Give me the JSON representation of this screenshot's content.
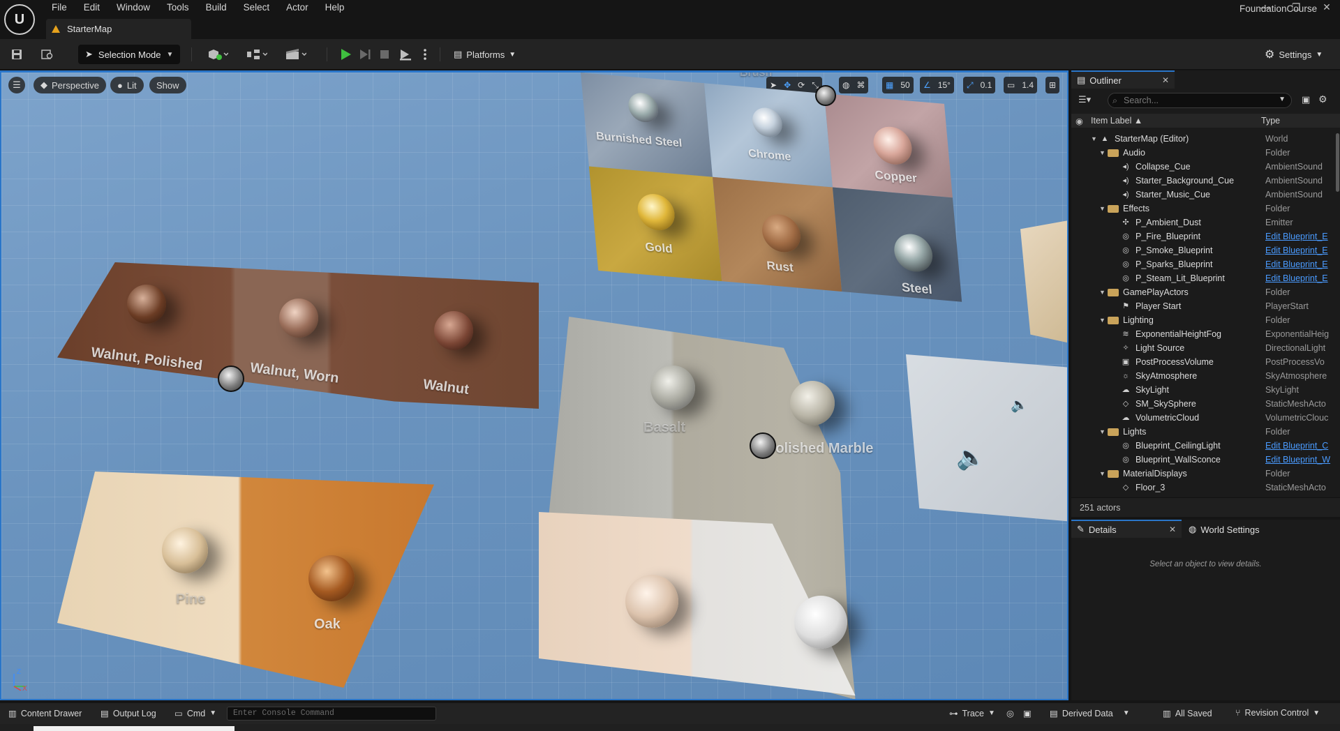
{
  "app": {
    "project_name": "FoundationCourse",
    "logo_letter": "U",
    "menu": [
      "File",
      "Edit",
      "Window",
      "Tools",
      "Build",
      "Select",
      "Actor",
      "Help"
    ],
    "map_tab": "StarterMap",
    "window_controls": [
      "—",
      "❐",
      "✕"
    ]
  },
  "toolbar": {
    "selection_mode": "Selection Mode",
    "platforms": "Platforms",
    "settings": "Settings",
    "icons": [
      "save-icon",
      "browse-icon",
      "add-actor-icon",
      "blueprint-icon",
      "cinematics-icon",
      "play-icon",
      "step-icon",
      "stop-icon",
      "eject-icon",
      "more-icon",
      "platforms-icon",
      "gear-icon"
    ],
    "colors": {
      "play": "#3fbf3f"
    }
  },
  "viewport": {
    "view_mode_perspective": "Perspective",
    "view_mode_lit": "Lit",
    "show": "Show",
    "grid_snap": "50",
    "rotation_snap": "15°",
    "scale_snap": "0.1",
    "camera_speed": "1.4",
    "accent": "#2a76c9",
    "material_tiles": [
      {
        "label": "Burnished Steel"
      },
      {
        "label": "Chrome"
      },
      {
        "label": "Copper"
      },
      {
        "label": "Gold"
      },
      {
        "label": "Rust"
      },
      {
        "label": "Steel"
      },
      {
        "label": "Walnut, Polished"
      },
      {
        "label": "Walnut, Worn"
      },
      {
        "label": "Walnut"
      },
      {
        "label": "Pine"
      },
      {
        "label": "Oak"
      },
      {
        "label": "Basalt"
      },
      {
        "label": "Polished Marble"
      },
      {
        "label": "Brush"
      }
    ],
    "axis": {
      "z": "Z",
      "x": "X"
    }
  },
  "outliner": {
    "title": "Outliner",
    "search_placeholder": "Search...",
    "col_label": "Item Label ▲",
    "col_type": "Type",
    "rows": [
      {
        "label": "StarterMap (Editor)",
        "type": "World",
        "depth": 0,
        "kind": "world"
      },
      {
        "label": "Audio",
        "type": "Folder",
        "depth": 1,
        "kind": "folder"
      },
      {
        "label": "Collapse_Cue",
        "type": "AmbientSound",
        "depth": 2,
        "kind": "sound"
      },
      {
        "label": "Starter_Background_Cue",
        "type": "AmbientSound",
        "depth": 2,
        "kind": "sound"
      },
      {
        "label": "Starter_Music_Cue",
        "type": "AmbientSound",
        "depth": 2,
        "kind": "sound"
      },
      {
        "label": "Effects",
        "type": "Folder",
        "depth": 1,
        "kind": "folder"
      },
      {
        "label": "P_Ambient_Dust",
        "type": "Emitter",
        "depth": 2,
        "kind": "emitter"
      },
      {
        "label": "P_Fire_Blueprint",
        "type": "Edit Blueprint_E",
        "depth": 2,
        "kind": "bp",
        "link": true
      },
      {
        "label": "P_Smoke_Blueprint",
        "type": "Edit Blueprint_E",
        "depth": 2,
        "kind": "bp",
        "link": true
      },
      {
        "label": "P_Sparks_Blueprint",
        "type": "Edit Blueprint_E",
        "depth": 2,
        "kind": "bp",
        "link": true
      },
      {
        "label": "P_Steam_Lit_Blueprint",
        "type": "Edit Blueprint_E",
        "depth": 2,
        "kind": "bp",
        "link": true
      },
      {
        "label": "GamePlayActors",
        "type": "Folder",
        "depth": 1,
        "kind": "folder"
      },
      {
        "label": "Player Start",
        "type": "PlayerStart",
        "depth": 2,
        "kind": "flag"
      },
      {
        "label": "Lighting",
        "type": "Folder",
        "depth": 1,
        "kind": "folder"
      },
      {
        "label": "ExponentialHeightFog",
        "type": "ExponentialHeig",
        "depth": 2,
        "kind": "fog"
      },
      {
        "label": "Light Source",
        "type": "DirectionalLight",
        "depth": 2,
        "kind": "light"
      },
      {
        "label": "PostProcessVolume",
        "type": "PostProcessVo",
        "depth": 2,
        "kind": "volume"
      },
      {
        "label": "SkyAtmosphere",
        "type": "SkyAtmosphere",
        "depth": 2,
        "kind": "sky"
      },
      {
        "label": "SkyLight",
        "type": "SkyLight",
        "depth": 2,
        "kind": "skylight"
      },
      {
        "label": "SM_SkySphere",
        "type": "StaticMeshActo",
        "depth": 2,
        "kind": "mesh"
      },
      {
        "label": "VolumetricCloud",
        "type": "VolumetricClouc",
        "depth": 2,
        "kind": "cloud"
      },
      {
        "label": "Lights",
        "type": "Folder",
        "depth": 1,
        "kind": "folder"
      },
      {
        "label": "Blueprint_CeilingLight",
        "type": "Edit Blueprint_C",
        "depth": 2,
        "kind": "bp",
        "link": true
      },
      {
        "label": "Blueprint_WallSconce",
        "type": "Edit Blueprint_W",
        "depth": 2,
        "kind": "bp",
        "link": true
      },
      {
        "label": "MaterialDisplays",
        "type": "Folder",
        "depth": 1,
        "kind": "folder"
      },
      {
        "label": "Floor_3",
        "type": "StaticMeshActo",
        "depth": 2,
        "kind": "mesh"
      }
    ],
    "actor_count": "251 actors"
  },
  "details": {
    "tab_details": "Details",
    "tab_world_settings": "World Settings",
    "hint": "Select an object to view details."
  },
  "statusbar": {
    "content_drawer": "Content Drawer",
    "output_log": "Output Log",
    "cmd": "Cmd",
    "console_placeholder": "Enter Console Command",
    "trace": "Trace",
    "derived_data": "Derived Data",
    "all_saved": "All Saved",
    "revision_control": "Revision Control"
  }
}
